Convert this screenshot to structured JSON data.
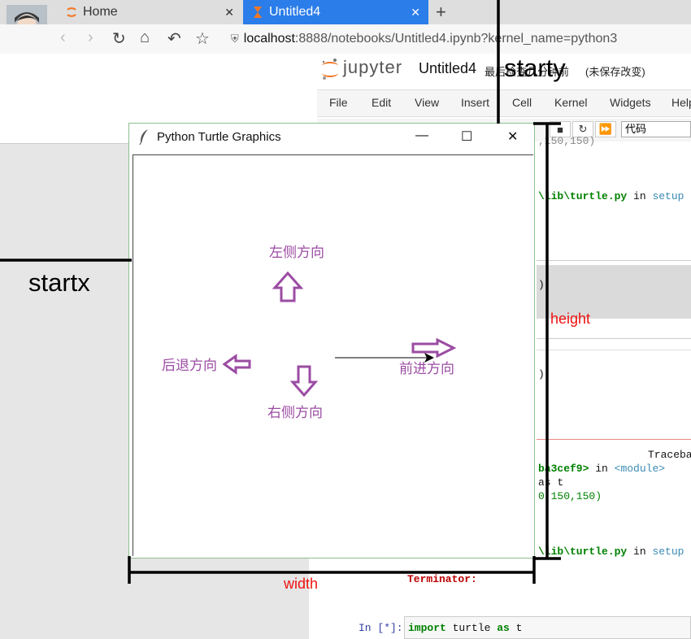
{
  "browser": {
    "tabs": [
      {
        "label": "Home",
        "active": false
      },
      {
        "label": "Untitled4",
        "active": true
      }
    ],
    "url_host": "localhost",
    "url_rest": ":8888/notebooks/Untitled4.ipynb?kernel_name=python3"
  },
  "jupyter": {
    "logo_text": "jupyter",
    "notebook_title": "Untitled4",
    "status_partial": "最后检查",
    "status_partial2": "几分钟前",
    "status_unsaved": "(未保存改变)",
    "menu": [
      "File",
      "Edit",
      "View",
      "Insert",
      "Cell",
      "Kernel",
      "Widgets",
      "Help"
    ],
    "cell_type": "代码",
    "code_lines": {
      "l1": ",150,150)",
      "l2a": "\\lib\\turtle.py",
      "l2b": " in ",
      "l2c": "setup",
      "l3": ")",
      "l4": ")",
      "tb_header": "Traceba",
      "tb_func": "ba3cef9>",
      "tb_in": " in ",
      "tb_module": "<module>",
      "tb_as": "as t",
      "tb_nums": "0,150,150)",
      "l5a": "\\lib\\turtle.py",
      "l5b": " in ",
      "l5c": "setup",
      "terminator": "Terminator:",
      "prompt": "In [*]:",
      "import_kw": "import",
      "import_rest": " turtle ",
      "as_kw": "as",
      "import_t": " t"
    }
  },
  "turtle_window": {
    "title": "Python Turtle Graphics",
    "labels": {
      "left": "左侧方向",
      "right": "右侧方向",
      "back": "后退方向",
      "forward": "前进方向"
    }
  },
  "annotations": {
    "starty": "starty",
    "startx": "startx",
    "height": "height",
    "width": "width"
  },
  "colors": {
    "tab_active": "#2b7de9",
    "arrow": "#9b4ca3",
    "annotation_red": "#e11111"
  }
}
